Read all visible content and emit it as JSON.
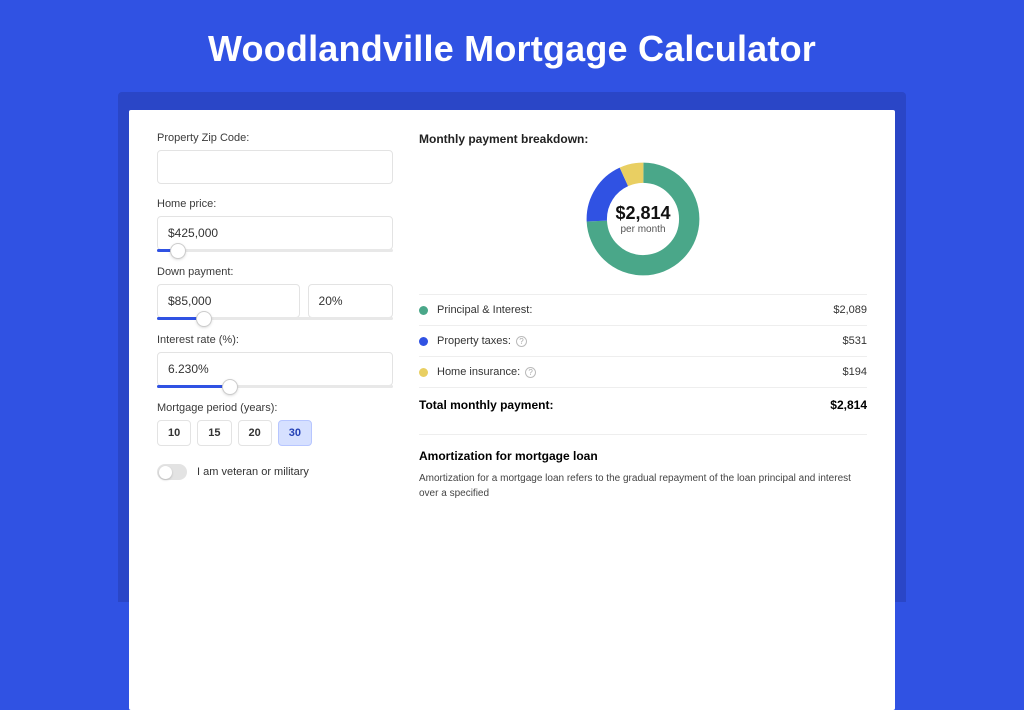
{
  "page": {
    "title": "Woodlandville Mortgage Calculator"
  },
  "form": {
    "zip_label": "Property Zip Code:",
    "zip_value": "",
    "home_price_label": "Home price:",
    "home_price_value": "$425,000",
    "home_price_slider_pct": 9,
    "down_payment_label": "Down payment:",
    "down_payment_value": "$85,000",
    "down_payment_pct_value": "20%",
    "down_payment_slider_pct": 20,
    "rate_label": "Interest rate (%):",
    "rate_value": "6.230%",
    "rate_slider_pct": 31,
    "period_label": "Mortgage period (years):",
    "periods": [
      "10",
      "15",
      "20",
      "30"
    ],
    "period_selected": "30",
    "vet_label": "I am veteran or military",
    "vet_on": false
  },
  "breakdown": {
    "title": "Monthly payment breakdown:",
    "center_value": "$2,814",
    "center_sub": "per month",
    "items": [
      {
        "label": "Principal & Interest:",
        "value": "$2,089",
        "color": "#4aa789",
        "hint": false
      },
      {
        "label": "Property taxes:",
        "value": "$531",
        "color": "#3052e3",
        "hint": true
      },
      {
        "label": "Home insurance:",
        "value": "$194",
        "color": "#e9cf62",
        "hint": true
      }
    ],
    "total_label": "Total monthly payment:",
    "total_value": "$2,814"
  },
  "amort": {
    "title": "Amortization for mortgage loan",
    "text": "Amortization for a mortgage loan refers to the gradual repayment of the loan principal and interest over a specified"
  },
  "chart_data": {
    "type": "pie",
    "title": "Monthly payment breakdown",
    "categories": [
      "Principal & Interest",
      "Property taxes",
      "Home insurance"
    ],
    "values": [
      2089,
      531,
      194
    ],
    "colors": [
      "#4aa789",
      "#3052e3",
      "#e9cf62"
    ],
    "total": 2814,
    "unit": "$ per month"
  }
}
